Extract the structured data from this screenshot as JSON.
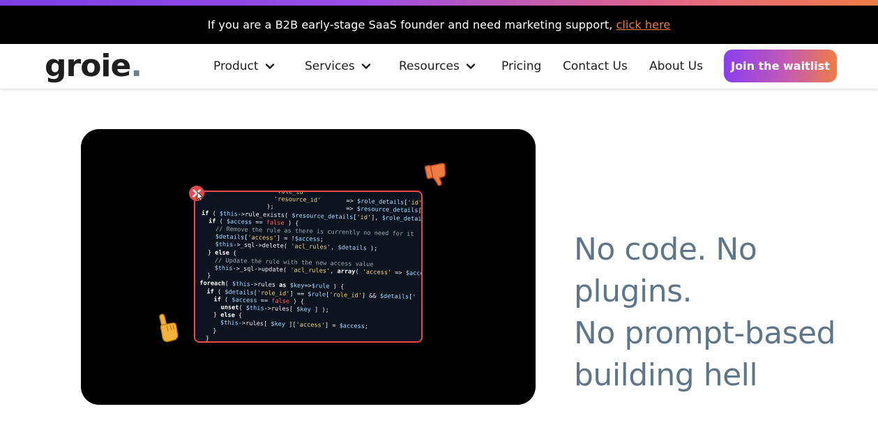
{
  "announcement": {
    "text": "If you are a B2B early-stage SaaS founder and need marketing support,",
    "link_label": "click here"
  },
  "nav": {
    "logo_text": "groie",
    "logo_dot": ".",
    "items": [
      {
        "label": "Product",
        "has_dropdown": true
      },
      {
        "label": "Services",
        "has_dropdown": true
      },
      {
        "label": "Resources",
        "has_dropdown": true
      },
      {
        "label": "Pricing",
        "has_dropdown": false
      },
      {
        "label": "Contact Us",
        "has_dropdown": false
      },
      {
        "label": "About Us",
        "has_dropdown": false
      }
    ],
    "cta_label": "Join the waitlist"
  },
  "hero": {
    "code_lines": [
      "                    'role_id'",
      "                    'resource_id'       => $role_details['id'],",
      "                  );                    => $resource_details['id'],",
      "if ( $this->rule_exists( $resource_details['id'], $role_details['i",
      "  if ( $access == false ) {",
      "    // Remove the rule as there is currently no need for it",
      "    $details['access'] = !$access;",
      "    $this->_sql->delete( 'acl_rules', $details );",
      "  } else {",
      "    // Update the rule with the new access value",
      "    $this->_sql->update( 'acl_rules', array( 'access' => $acce",
      "  }",
      "foreach( $this->rules as $key=>$rule ) {",
      "  if ( $details['role_id'] == $rule['role_id'] && $details['",
      "    if ( $access == false ) {",
      "      unset( $this->rules[ $key ] );",
      "    } else {",
      "      $this->rules[ $key ]['access'] = $access;",
      "    }",
      "  }"
    ],
    "headline_lines": [
      "No code. No plugins.",
      "No prompt-based",
      "building hell"
    ]
  },
  "colors": {
    "accent_orange": "#f07c45",
    "accent_purple": "#8a3ff0",
    "headline": "#5e7689",
    "frame_red": "#e8484a"
  },
  "icons": {
    "dropdown": "chevron-down-icon",
    "close": "close-x-icon",
    "thumbs_down": "thumbs-down-icon",
    "pointer": "pointing-hand-icon"
  }
}
